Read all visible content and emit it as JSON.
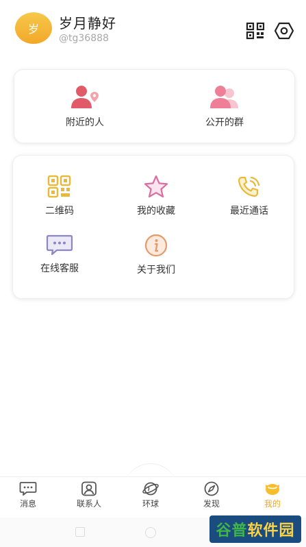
{
  "profile": {
    "avatar_text": "岁",
    "name": "岁月静好",
    "handle": "@tg36888"
  },
  "header_icons": [
    "qr-code-icon",
    "settings-hexagon-icon"
  ],
  "card_top": {
    "items": [
      {
        "label": "附近的人",
        "icon": "nearby-person-icon",
        "color": "#e05a67"
      },
      {
        "label": "公开的群",
        "icon": "group-icon",
        "color": "#ee7f96"
      }
    ]
  },
  "card_grid": {
    "items": [
      {
        "label": "二维码",
        "icon": "qr-code-icon",
        "color": "#e8b93a"
      },
      {
        "label": "我的收藏",
        "icon": "star-icon",
        "color": "#d96fa0"
      },
      {
        "label": "最近通话",
        "icon": "phone-call-icon",
        "color": "#e8b93a"
      },
      {
        "label": "在线客服",
        "icon": "chat-bubble-icon",
        "color": "#8b86c4"
      },
      {
        "label": "关于我们",
        "icon": "info-icon",
        "color": "#e59a6a"
      }
    ]
  },
  "bottom_nav": {
    "items": [
      {
        "label": "消息",
        "icon": "message-icon"
      },
      {
        "label": "联系人",
        "icon": "contacts-icon"
      },
      {
        "label": "环球",
        "icon": "globe-icon"
      },
      {
        "label": "发现",
        "icon": "compass-icon"
      },
      {
        "label": "我的",
        "icon": "me-icon",
        "active": true
      }
    ],
    "active_color": "#f0a81f"
  },
  "watermark": {
    "part1": "谷普",
    "part2": "软件园"
  }
}
